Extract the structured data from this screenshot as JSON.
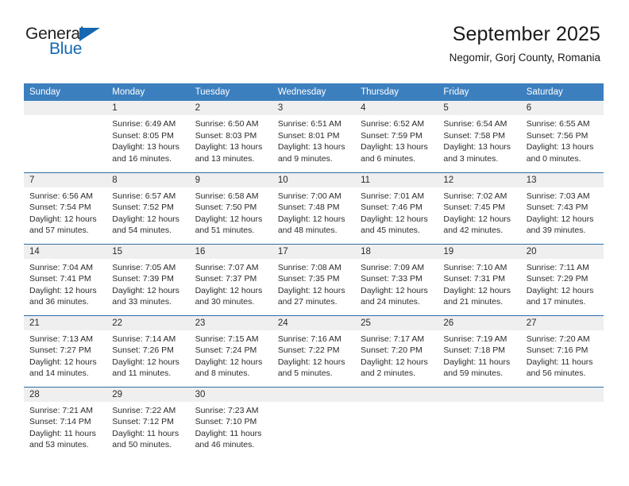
{
  "brand": {
    "name_part1": "General",
    "name_part2": "Blue",
    "accent_color": "#1567b0"
  },
  "header": {
    "title": "September 2025",
    "subtitle": "Negomir, Gorj County, Romania"
  },
  "calendar": {
    "header_color": "#3c7fbf",
    "row_separator_color": "#2e6da4",
    "daynum_band_color": "#efefef",
    "weekdays": [
      "Sunday",
      "Monday",
      "Tuesday",
      "Wednesday",
      "Thursday",
      "Friday",
      "Saturday"
    ],
    "weeks": [
      [
        {
          "day": "",
          "sunrise": "",
          "sunset": "",
          "daylight_line1": "",
          "daylight_line2": ""
        },
        {
          "day": "1",
          "sunrise": "Sunrise: 6:49 AM",
          "sunset": "Sunset: 8:05 PM",
          "daylight_line1": "Daylight: 13 hours",
          "daylight_line2": "and 16 minutes."
        },
        {
          "day": "2",
          "sunrise": "Sunrise: 6:50 AM",
          "sunset": "Sunset: 8:03 PM",
          "daylight_line1": "Daylight: 13 hours",
          "daylight_line2": "and 13 minutes."
        },
        {
          "day": "3",
          "sunrise": "Sunrise: 6:51 AM",
          "sunset": "Sunset: 8:01 PM",
          "daylight_line1": "Daylight: 13 hours",
          "daylight_line2": "and 9 minutes."
        },
        {
          "day": "4",
          "sunrise": "Sunrise: 6:52 AM",
          "sunset": "Sunset: 7:59 PM",
          "daylight_line1": "Daylight: 13 hours",
          "daylight_line2": "and 6 minutes."
        },
        {
          "day": "5",
          "sunrise": "Sunrise: 6:54 AM",
          "sunset": "Sunset: 7:58 PM",
          "daylight_line1": "Daylight: 13 hours",
          "daylight_line2": "and 3 minutes."
        },
        {
          "day": "6",
          "sunrise": "Sunrise: 6:55 AM",
          "sunset": "Sunset: 7:56 PM",
          "daylight_line1": "Daylight: 13 hours",
          "daylight_line2": "and 0 minutes."
        }
      ],
      [
        {
          "day": "7",
          "sunrise": "Sunrise: 6:56 AM",
          "sunset": "Sunset: 7:54 PM",
          "daylight_line1": "Daylight: 12 hours",
          "daylight_line2": "and 57 minutes."
        },
        {
          "day": "8",
          "sunrise": "Sunrise: 6:57 AM",
          "sunset": "Sunset: 7:52 PM",
          "daylight_line1": "Daylight: 12 hours",
          "daylight_line2": "and 54 minutes."
        },
        {
          "day": "9",
          "sunrise": "Sunrise: 6:58 AM",
          "sunset": "Sunset: 7:50 PM",
          "daylight_line1": "Daylight: 12 hours",
          "daylight_line2": "and 51 minutes."
        },
        {
          "day": "10",
          "sunrise": "Sunrise: 7:00 AM",
          "sunset": "Sunset: 7:48 PM",
          "daylight_line1": "Daylight: 12 hours",
          "daylight_line2": "and 48 minutes."
        },
        {
          "day": "11",
          "sunrise": "Sunrise: 7:01 AM",
          "sunset": "Sunset: 7:46 PM",
          "daylight_line1": "Daylight: 12 hours",
          "daylight_line2": "and 45 minutes."
        },
        {
          "day": "12",
          "sunrise": "Sunrise: 7:02 AM",
          "sunset": "Sunset: 7:45 PM",
          "daylight_line1": "Daylight: 12 hours",
          "daylight_line2": "and 42 minutes."
        },
        {
          "day": "13",
          "sunrise": "Sunrise: 7:03 AM",
          "sunset": "Sunset: 7:43 PM",
          "daylight_line1": "Daylight: 12 hours",
          "daylight_line2": "and 39 minutes."
        }
      ],
      [
        {
          "day": "14",
          "sunrise": "Sunrise: 7:04 AM",
          "sunset": "Sunset: 7:41 PM",
          "daylight_line1": "Daylight: 12 hours",
          "daylight_line2": "and 36 minutes."
        },
        {
          "day": "15",
          "sunrise": "Sunrise: 7:05 AM",
          "sunset": "Sunset: 7:39 PM",
          "daylight_line1": "Daylight: 12 hours",
          "daylight_line2": "and 33 minutes."
        },
        {
          "day": "16",
          "sunrise": "Sunrise: 7:07 AM",
          "sunset": "Sunset: 7:37 PM",
          "daylight_line1": "Daylight: 12 hours",
          "daylight_line2": "and 30 minutes."
        },
        {
          "day": "17",
          "sunrise": "Sunrise: 7:08 AM",
          "sunset": "Sunset: 7:35 PM",
          "daylight_line1": "Daylight: 12 hours",
          "daylight_line2": "and 27 minutes."
        },
        {
          "day": "18",
          "sunrise": "Sunrise: 7:09 AM",
          "sunset": "Sunset: 7:33 PM",
          "daylight_line1": "Daylight: 12 hours",
          "daylight_line2": "and 24 minutes."
        },
        {
          "day": "19",
          "sunrise": "Sunrise: 7:10 AM",
          "sunset": "Sunset: 7:31 PM",
          "daylight_line1": "Daylight: 12 hours",
          "daylight_line2": "and 21 minutes."
        },
        {
          "day": "20",
          "sunrise": "Sunrise: 7:11 AM",
          "sunset": "Sunset: 7:29 PM",
          "daylight_line1": "Daylight: 12 hours",
          "daylight_line2": "and 17 minutes."
        }
      ],
      [
        {
          "day": "21",
          "sunrise": "Sunrise: 7:13 AM",
          "sunset": "Sunset: 7:27 PM",
          "daylight_line1": "Daylight: 12 hours",
          "daylight_line2": "and 14 minutes."
        },
        {
          "day": "22",
          "sunrise": "Sunrise: 7:14 AM",
          "sunset": "Sunset: 7:26 PM",
          "daylight_line1": "Daylight: 12 hours",
          "daylight_line2": "and 11 minutes."
        },
        {
          "day": "23",
          "sunrise": "Sunrise: 7:15 AM",
          "sunset": "Sunset: 7:24 PM",
          "daylight_line1": "Daylight: 12 hours",
          "daylight_line2": "and 8 minutes."
        },
        {
          "day": "24",
          "sunrise": "Sunrise: 7:16 AM",
          "sunset": "Sunset: 7:22 PM",
          "daylight_line1": "Daylight: 12 hours",
          "daylight_line2": "and 5 minutes."
        },
        {
          "day": "25",
          "sunrise": "Sunrise: 7:17 AM",
          "sunset": "Sunset: 7:20 PM",
          "daylight_line1": "Daylight: 12 hours",
          "daylight_line2": "and 2 minutes."
        },
        {
          "day": "26",
          "sunrise": "Sunrise: 7:19 AM",
          "sunset": "Sunset: 7:18 PM",
          "daylight_line1": "Daylight: 11 hours",
          "daylight_line2": "and 59 minutes."
        },
        {
          "day": "27",
          "sunrise": "Sunrise: 7:20 AM",
          "sunset": "Sunset: 7:16 PM",
          "daylight_line1": "Daylight: 11 hours",
          "daylight_line2": "and 56 minutes."
        }
      ],
      [
        {
          "day": "28",
          "sunrise": "Sunrise: 7:21 AM",
          "sunset": "Sunset: 7:14 PM",
          "daylight_line1": "Daylight: 11 hours",
          "daylight_line2": "and 53 minutes."
        },
        {
          "day": "29",
          "sunrise": "Sunrise: 7:22 AM",
          "sunset": "Sunset: 7:12 PM",
          "daylight_line1": "Daylight: 11 hours",
          "daylight_line2": "and 50 minutes."
        },
        {
          "day": "30",
          "sunrise": "Sunrise: 7:23 AM",
          "sunset": "Sunset: 7:10 PM",
          "daylight_line1": "Daylight: 11 hours",
          "daylight_line2": "and 46 minutes."
        },
        {
          "day": "",
          "sunrise": "",
          "sunset": "",
          "daylight_line1": "",
          "daylight_line2": ""
        },
        {
          "day": "",
          "sunrise": "",
          "sunset": "",
          "daylight_line1": "",
          "daylight_line2": ""
        },
        {
          "day": "",
          "sunrise": "",
          "sunset": "",
          "daylight_line1": "",
          "daylight_line2": ""
        },
        {
          "day": "",
          "sunrise": "",
          "sunset": "",
          "daylight_line1": "",
          "daylight_line2": ""
        }
      ]
    ]
  }
}
